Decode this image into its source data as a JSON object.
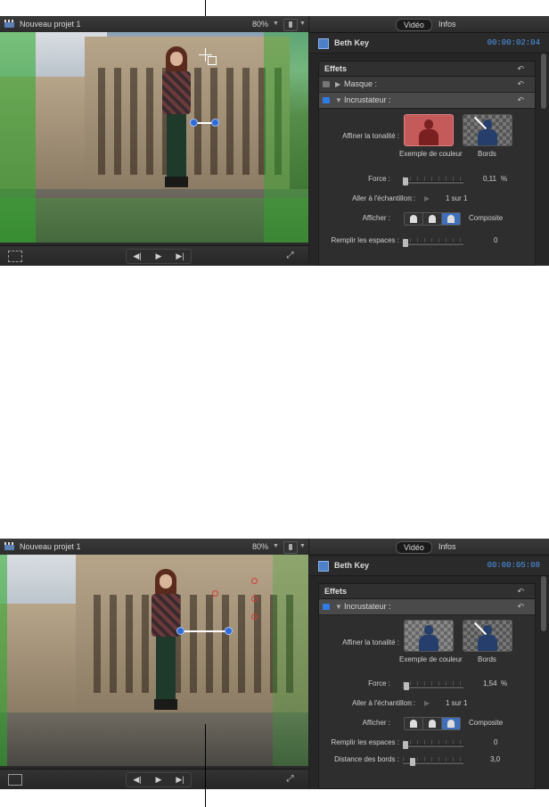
{
  "screens": [
    {
      "project_name": "Nouveau projet 1",
      "zoom": "80%",
      "tabs": [
        "Vidéo",
        "Infos"
      ],
      "clip_name": "Beth Key",
      "timecode": "00:00:02:04",
      "effects_header": "Effets",
      "effects": [
        {
          "label": "Masque :",
          "enabled": false,
          "expanded": false
        },
        {
          "label": "Incrustateur :",
          "enabled": true,
          "expanded": true
        }
      ],
      "params": {
        "refine_label": "Affiner la tonalité :",
        "color_sample_label": "Exemple de couleur",
        "edges_label": "Bords",
        "strength_label": "Force :",
        "strength_value": "0,11",
        "strength_unit": "%",
        "goto_sample_label": "Aller à l'échantillon :",
        "sample_counter": "1 sur 1",
        "view_label": "Afficher :",
        "view_value": "Composite",
        "fill_holes_label": "Remplir les espaces :",
        "fill_holes_value": "0"
      },
      "icons": [
        "clapper-icon",
        "chevron-down-icon",
        "transform-icon",
        "previous-icon",
        "play-icon",
        "next-icon",
        "fullscreen-icon",
        "reset-icon"
      ]
    },
    {
      "project_name": "Nouveau projet 1",
      "zoom": "80%",
      "tabs": [
        "Vidéo",
        "Infos"
      ],
      "clip_name": "Beth Key",
      "timecode": "00:00:05:08",
      "effects_header": "Effets",
      "effects": [
        {
          "label": "Incrustateur :",
          "enabled": true,
          "expanded": true
        }
      ],
      "params": {
        "refine_label": "Affiner la tonalité :",
        "color_sample_label": "Exemple de couleur",
        "edges_label": "Bords",
        "strength_label": "Force :",
        "strength_value": "1,54",
        "strength_unit": "%",
        "goto_sample_label": "Aller à l'échantillon :",
        "sample_counter": "1 sur 1",
        "view_label": "Afficher :",
        "view_value": "Composite",
        "fill_holes_label": "Remplir les espaces :",
        "fill_holes_value": "0",
        "edge_distance_label": "Distance des bords :",
        "edge_distance_value": "3,0"
      },
      "icons": [
        "clapper-icon",
        "chevron-down-icon",
        "crop-icon",
        "previous-icon",
        "play-icon",
        "next-icon",
        "fullscreen-icon",
        "reset-icon"
      ]
    }
  ],
  "colors": {
    "accent_blue": "#2f7be6",
    "timecode_blue": "#4e9af1",
    "chroma_green": "#28aa28",
    "sample_red": "#c45a5a"
  },
  "transport": {
    "prev": "◀|",
    "play": "▶",
    "next": "▶|"
  }
}
